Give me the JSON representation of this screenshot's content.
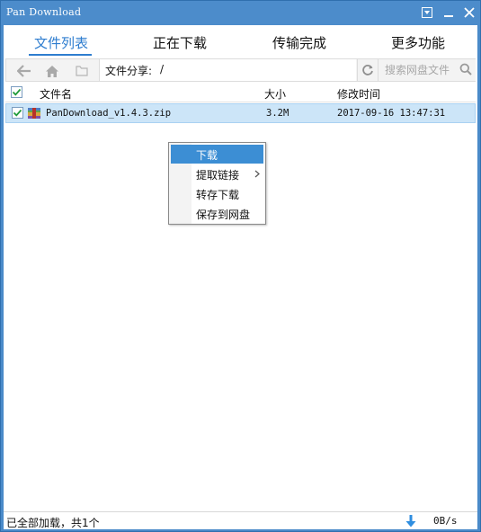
{
  "window": {
    "title": "Pan Download",
    "colors": {
      "frame": "#4c8ccb",
      "accent": "#2e7dcf",
      "selection": "#cce5f8",
      "menu_highlight": "#3c8ed4"
    }
  },
  "tabs": [
    {
      "label": "文件列表",
      "active": true
    },
    {
      "label": "正在下载",
      "active": false
    },
    {
      "label": "传输完成",
      "active": false
    },
    {
      "label": "更多功能",
      "active": false
    }
  ],
  "toolbar": {
    "icons": [
      "back-arrow-icon",
      "home-icon",
      "folder-icon",
      "refresh-icon",
      "search-icon"
    ],
    "path_label": "文件分享:",
    "path_value": "/",
    "search_placeholder": "搜索网盘文件"
  },
  "list": {
    "columns": {
      "name": "文件名",
      "size": "大小",
      "modified": "修改时间"
    },
    "rows": [
      {
        "name": "PanDownload_v1.4.3.zip",
        "size": "3.2M",
        "modified": "2017-09-16 13:47:31",
        "checked": true,
        "icon": "archive-icon"
      }
    ]
  },
  "context_menu": {
    "items": [
      {
        "label": "下载",
        "highlighted": true
      },
      {
        "label": "提取链接",
        "submenu": true
      },
      {
        "label": "转存下载"
      },
      {
        "label": "保存到网盘"
      }
    ]
  },
  "status": {
    "text": "已全部加载，共1个",
    "speed": "0B/s"
  }
}
